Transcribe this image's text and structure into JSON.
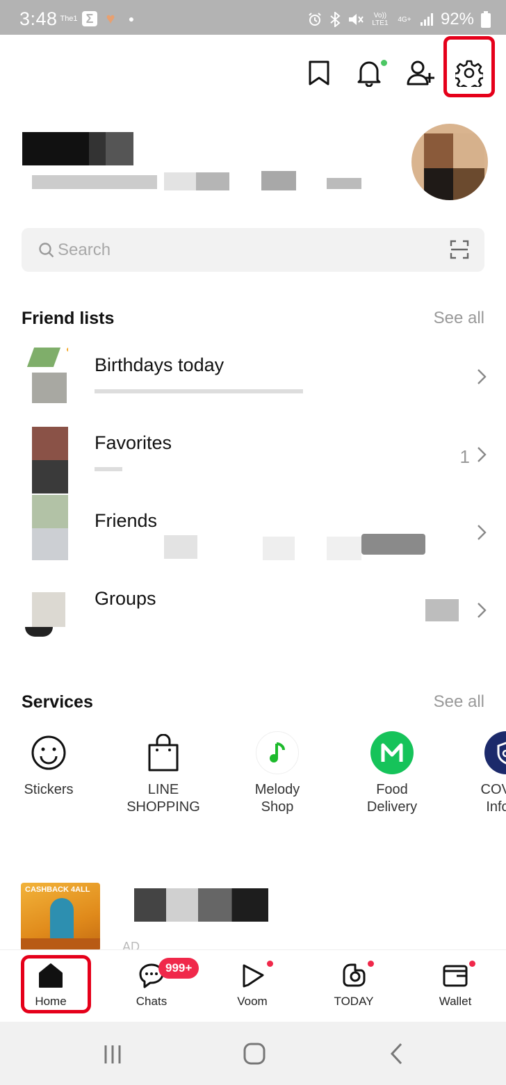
{
  "status_bar": {
    "time": "3:48",
    "battery": "92%",
    "network_top": "Vo)) LTE1",
    "network_gen": "4G+"
  },
  "top_actions": {
    "icons": [
      "bookmark-icon",
      "bell-icon",
      "add-friend-icon",
      "gear-icon"
    ]
  },
  "search": {
    "placeholder": "Search"
  },
  "friend_lists": {
    "title": "Friend lists",
    "see_all": "See all",
    "items": [
      {
        "label": "Birthdays today",
        "count": ""
      },
      {
        "label": "Favorites",
        "count": "1"
      },
      {
        "label": "Friends",
        "count": ""
      },
      {
        "label": "Groups",
        "count": ""
      }
    ]
  },
  "services": {
    "title": "Services",
    "see_all": "See all",
    "items": [
      {
        "label": "Stickers",
        "icon": "smiley-icon"
      },
      {
        "label": "LINE SHOPPING",
        "icon": "shopping-bag-icon"
      },
      {
        "label": "Melody Shop",
        "icon": "music-note-icon",
        "color": "#1dba2c"
      },
      {
        "label": "Food Delivery",
        "icon": "m-logo-icon",
        "color": "#16c35a"
      },
      {
        "label": "COVI Info",
        "icon": "shield-icon",
        "color": "#1c2a6b"
      }
    ]
  },
  "ad": {
    "image_text": "CASHBACK 4ALL",
    "sub": "AD"
  },
  "bottom_nav": {
    "items": [
      {
        "label": "Home",
        "icon": "home-icon"
      },
      {
        "label": "Chats",
        "icon": "chat-bubble-icon"
      },
      {
        "label": "Voom",
        "icon": "play-icon"
      },
      {
        "label": "TODAY",
        "icon": "today-icon"
      },
      {
        "label": "Wallet",
        "icon": "wallet-icon"
      }
    ],
    "chats_badge": "999+",
    "accent": "#f0284a",
    "highlight": "#e5001a"
  }
}
